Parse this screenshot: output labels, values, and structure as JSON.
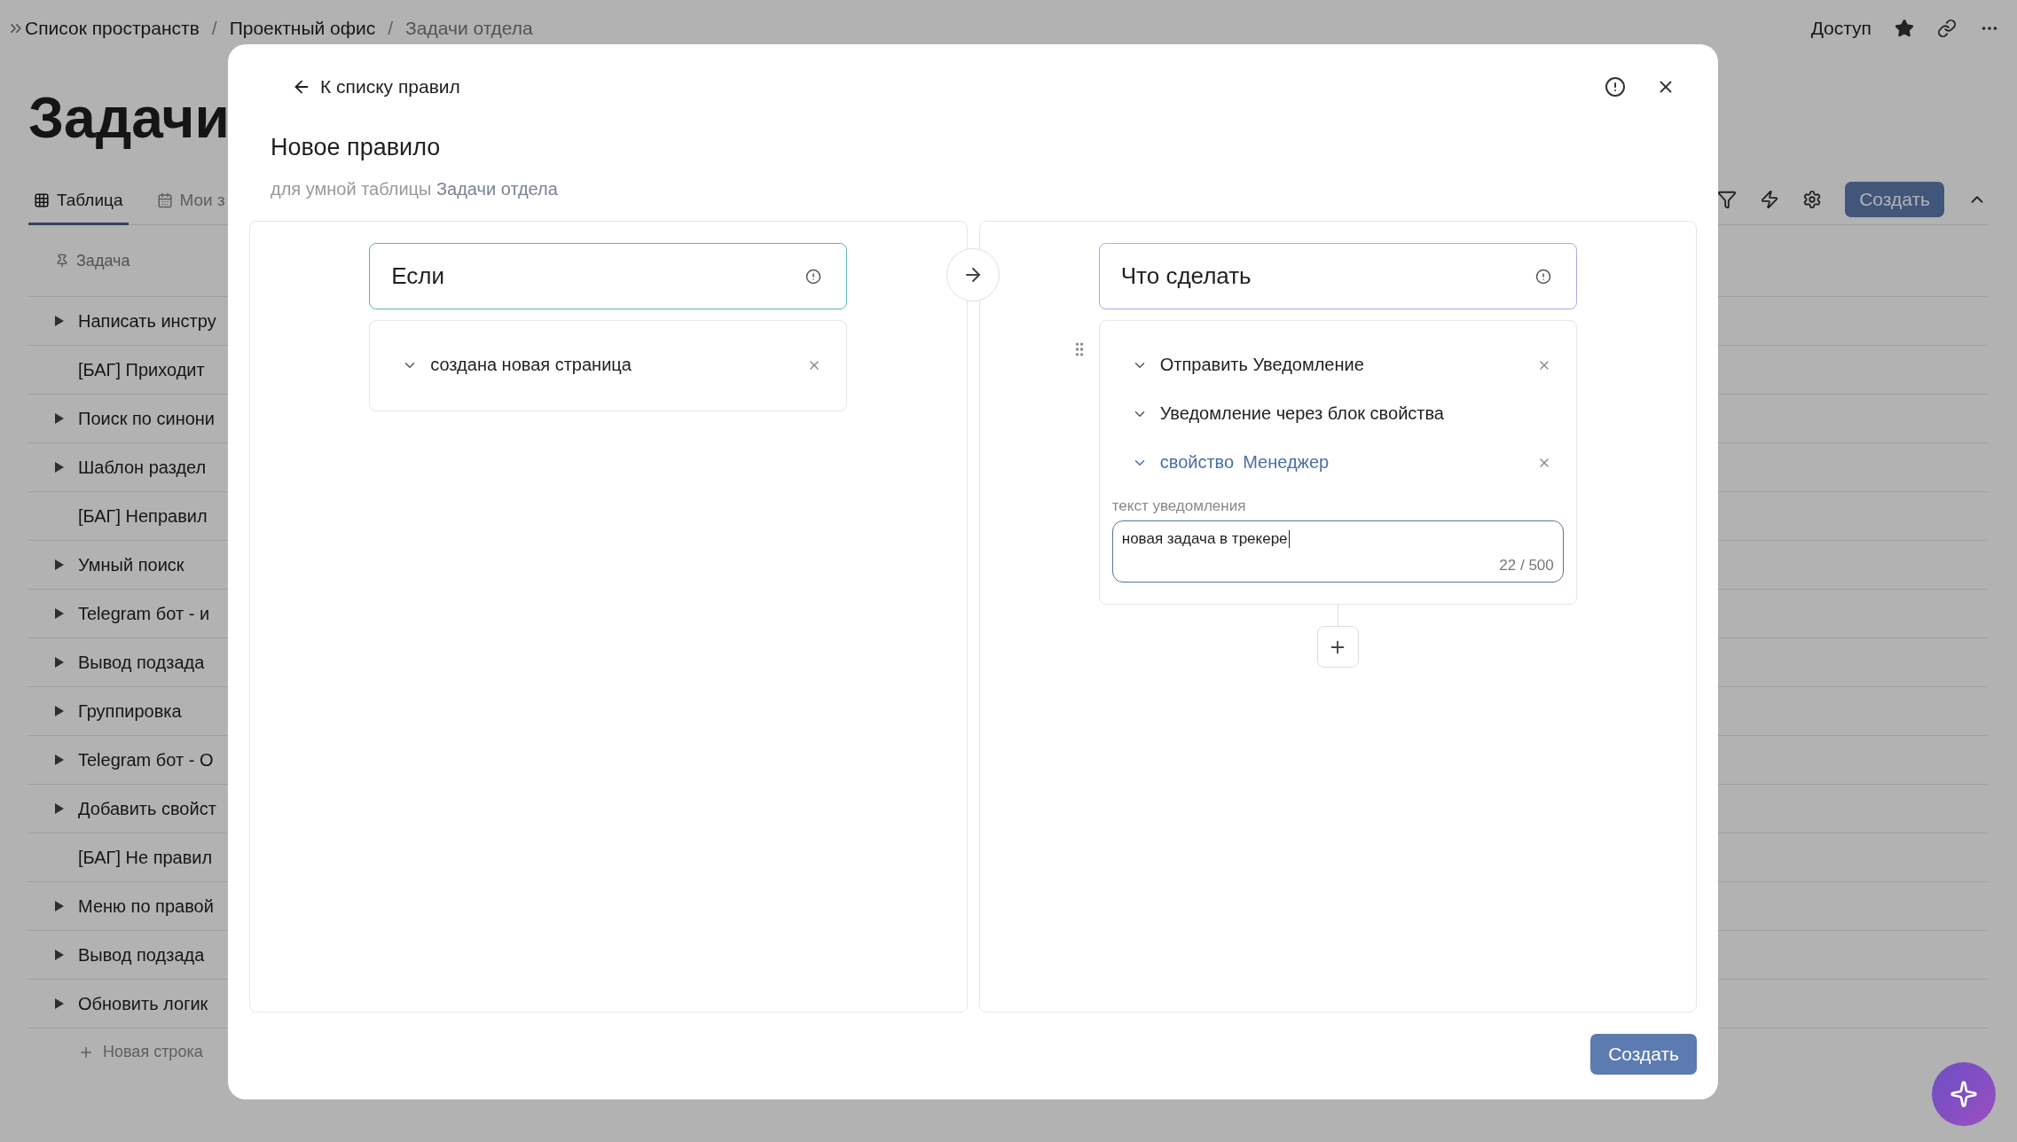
{
  "breadcrumbs": [
    {
      "label": "Список пространств",
      "current": false
    },
    {
      "label": "Проектный офис",
      "current": false
    },
    {
      "label": "Задачи отдела",
      "current": true
    }
  ],
  "separators": [
    "/",
    "/"
  ],
  "header_actions": {
    "access": "Доступ",
    "starred": true
  },
  "page_title": "Задачи",
  "view_tabs": [
    {
      "label": "Таблица",
      "selected": true
    },
    {
      "label": "Мои з",
      "selected": false
    }
  ],
  "toolbar": {
    "create": "Создать"
  },
  "table": {
    "column": "Задача",
    "new_row": "Новая строка",
    "rows": [
      {
        "title": "Написать инстру",
        "has_children": true
      },
      {
        "title": "[БАГ] Приходит",
        "has_children": false
      },
      {
        "title": "Поиск по синони",
        "has_children": true
      },
      {
        "title": "Шаблон раздел",
        "has_children": true
      },
      {
        "title": "[БАГ] Неправил",
        "has_children": false
      },
      {
        "title": "Умный поиск",
        "has_children": true
      },
      {
        "title": "Telegram бот - и",
        "has_children": true
      },
      {
        "title": "Вывод подзада",
        "has_children": true
      },
      {
        "title": "Группировка",
        "has_children": true
      },
      {
        "title": "Telegram бот - О",
        "has_children": true
      },
      {
        "title": "Добавить свойст",
        "has_children": true
      },
      {
        "title": "[БАГ] Не правил",
        "has_children": false
      },
      {
        "title": "Меню по правой",
        "has_children": true
      },
      {
        "title": "Вывод подзада",
        "has_children": true
      },
      {
        "title": "Обновить логик",
        "has_children": true
      }
    ]
  },
  "dialog": {
    "back": "К списку правил",
    "title": "Новое правило",
    "subtitle": "для умной таблицы",
    "table_name": "Задачи отдела",
    "trigger": {
      "heading": "Если",
      "items": [
        {
          "label": "создана новая страница",
          "removable": true
        }
      ]
    },
    "action": {
      "heading": "Что сделать",
      "items": [
        {
          "kind": "action",
          "label": "Отправить Уведомление",
          "removable": true
        },
        {
          "kind": "option",
          "label": "Уведомление через блок свойства",
          "removable": false
        },
        {
          "kind": "property",
          "label": "свойство",
          "value": "Менеджер",
          "removable": true
        }
      ],
      "message_label": "текст уведомления",
      "message": "новая задача в трекере",
      "counter": "22 / 500"
    },
    "submit": "Создать"
  }
}
